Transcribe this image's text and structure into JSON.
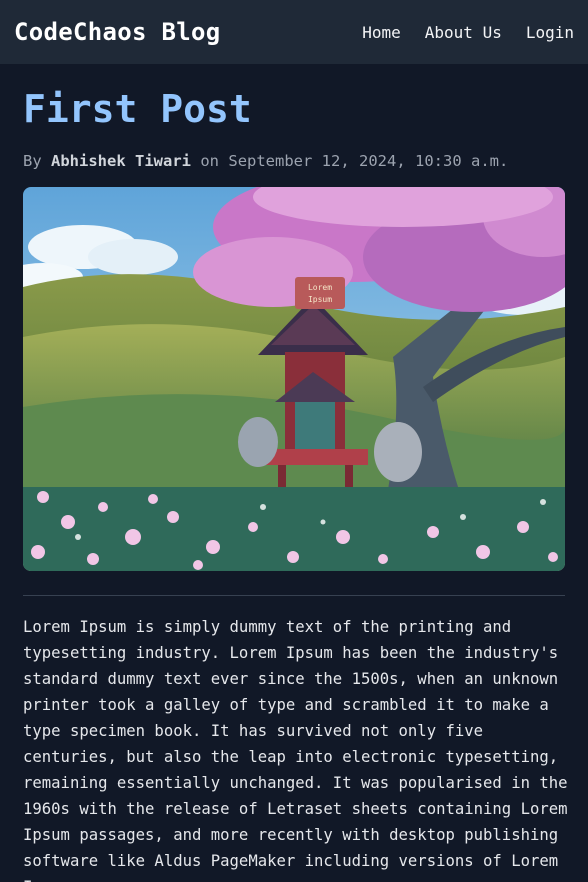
{
  "nav": {
    "brand": "CodeChaos Blog",
    "links": [
      "Home",
      "About Us",
      "Login"
    ]
  },
  "post": {
    "title": "First Post",
    "by_label": "By",
    "author": "Abhishek Tiwari",
    "on_label": "on",
    "date": "September 12, 2024, 10:30 a.m.",
    "image_sign": [
      "Lorem",
      "Ipsum"
    ],
    "body": "Lorem Ipsum is simply dummy text of the printing and typesetting industry. Lorem Ipsum has been the industry's standard dummy text ever since the 1500s, when an unknown printer took a galley of type and scrambled it to make a type specimen book. It has survived not only five centuries, but also the leap into electronic typesetting, remaining essentially unchanged. It was popularised in the 1960s with the release of Letraset sheets containing Lorem Ipsum passages, and more recently with desktop publishing software like Aldus PageMaker including versions of Lorem Ipsum."
  },
  "colors": {
    "background": "#111827",
    "navbar": "#1f2937",
    "title": "#93c5fd"
  }
}
